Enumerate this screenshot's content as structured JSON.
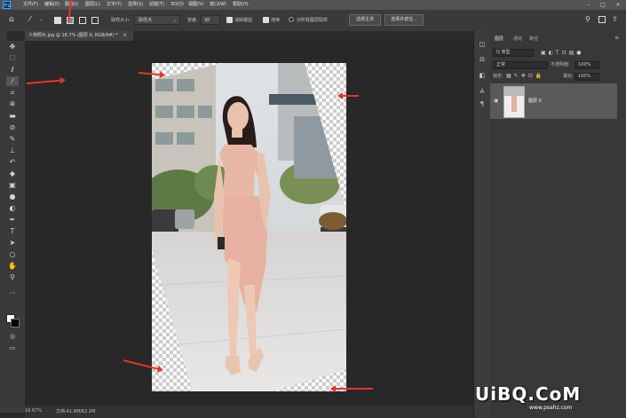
{
  "menubar": {
    "logo": "Ps",
    "items": [
      "文件(F)",
      "编辑(E)",
      "图像(I)",
      "图层(L)",
      "文字(Y)",
      "选择(S)",
      "滤镜(T)",
      "3D(D)",
      "视图(V)",
      "窗口(W)",
      "帮助(H)"
    ]
  },
  "options": {
    "sample_size_label": "取样大小:",
    "sample_size_value": "取样点",
    "tolerance_label": "容差:",
    "tolerance_value": "30",
    "antialias_label": "消除锯齿",
    "contiguous_label": "连续",
    "all_layers_label": "对所有图层取样",
    "select_subject": "选择主体",
    "select_and_mask": "选择并遮住..."
  },
  "document": {
    "tab_label": "人物照片.jpg @ 16.7% (图层 0, RGB/8#) *",
    "tab_close": "×"
  },
  "status": {
    "zoom": "16.67%",
    "doc_size": "文档:41.8M/62.2M"
  },
  "panel": {
    "tabs": [
      "图层",
      "通道",
      "路径"
    ],
    "kind_label": "Q 类型",
    "blend_mode": "正常",
    "opacity_label": "不透明度:",
    "opacity_value": "100%",
    "lock_label": "锁定:",
    "fill_label": "填充:",
    "fill_value": "100%",
    "layer_name": "图层 0"
  },
  "watermark": {
    "main": "UiBQ.CoM",
    "sub": "www.psahz.com"
  },
  "colors": {
    "accent_arrow": "#e8322a",
    "ps_blue": "#31a8ff"
  }
}
